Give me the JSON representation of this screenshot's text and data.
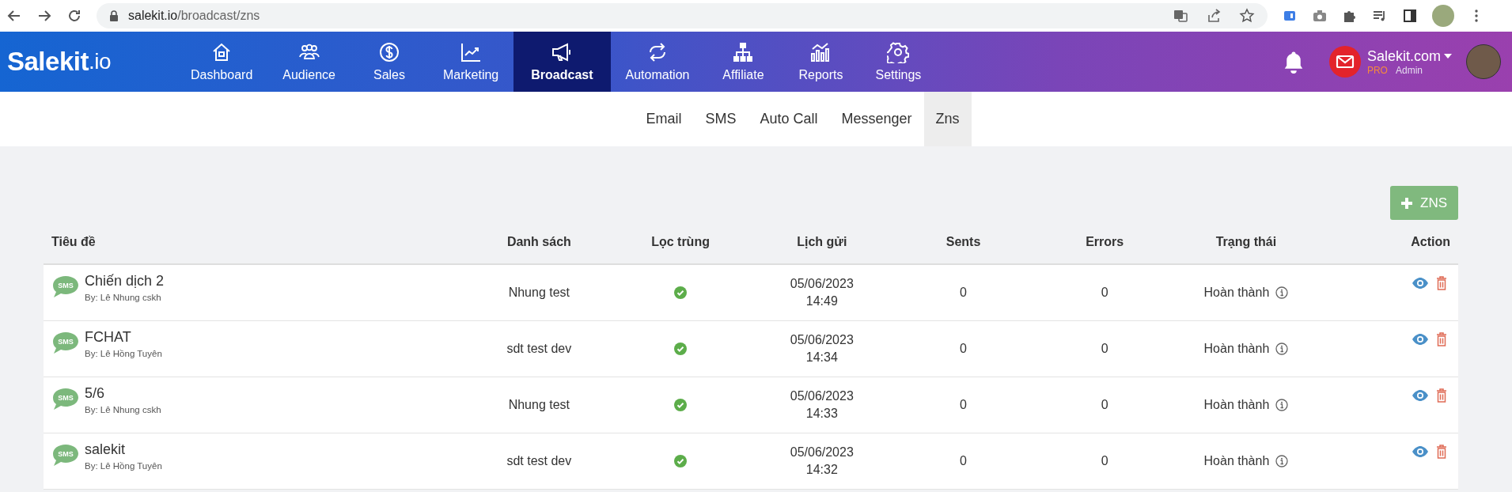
{
  "browser": {
    "url_host": "salekit.io",
    "url_path": "/broadcast/zns"
  },
  "brand": {
    "logo": "Salekit",
    "logo_suffix": ".io"
  },
  "nav": [
    {
      "label": "Dashboard",
      "selected": false
    },
    {
      "label": "Audience",
      "selected": false
    },
    {
      "label": "Sales",
      "selected": false
    },
    {
      "label": "Marketing",
      "selected": false
    },
    {
      "label": "Broadcast",
      "selected": true
    },
    {
      "label": "Automation",
      "selected": false
    },
    {
      "label": "Affiliate",
      "selected": false
    },
    {
      "label": "Reports",
      "selected": false
    },
    {
      "label": "Settings",
      "selected": false
    }
  ],
  "account": {
    "name": "Salekit.com",
    "plan": "PRO",
    "role": "Admin"
  },
  "tabs": [
    {
      "label": "Email",
      "selected": false
    },
    {
      "label": "SMS",
      "selected": false
    },
    {
      "label": "Auto Call",
      "selected": false
    },
    {
      "label": "Messenger",
      "selected": false
    },
    {
      "label": "Zns",
      "selected": true
    }
  ],
  "add_button": {
    "label": "ZNS"
  },
  "table": {
    "columns": [
      "Tiêu đề",
      "Danh sách",
      "Lọc trùng",
      "Lịch gửi",
      "Sents",
      "Errors",
      "Trạng thái",
      "Action"
    ],
    "rows": [
      {
        "badge": "SMS",
        "title": "Chiến dịch 2",
        "author": "By: Lê Nhung cskh",
        "list": "Nhung test",
        "dedupe": true,
        "date": "05/06/2023",
        "time": "14:49",
        "sents": "0",
        "errors": "0",
        "status": "Hoàn thành"
      },
      {
        "badge": "SMS",
        "title": "FCHAT",
        "author": "By: Lê Hồng Tuyên",
        "list": "sdt test dev",
        "dedupe": true,
        "date": "05/06/2023",
        "time": "14:34",
        "sents": "0",
        "errors": "0",
        "status": "Hoàn thành"
      },
      {
        "badge": "SMS",
        "title": "5/6",
        "author": "By: Lê Nhung cskh",
        "list": "Nhung test",
        "dedupe": true,
        "date": "05/06/2023",
        "time": "14:33",
        "sents": "0",
        "errors": "0",
        "status": "Hoàn thành"
      },
      {
        "badge": "SMS",
        "title": "salekit",
        "author": "By: Lê Hồng Tuyên",
        "list": "sdt test dev",
        "dedupe": true,
        "date": "05/06/2023",
        "time": "14:32",
        "sents": "0",
        "errors": "0",
        "status": "Hoàn thành"
      }
    ]
  }
}
